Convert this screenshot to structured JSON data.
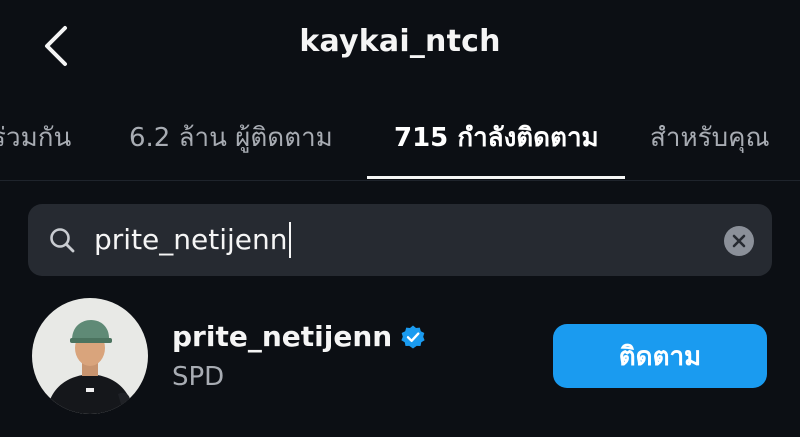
{
  "header": {
    "title": "kaykai_ntch"
  },
  "tabs": [
    {
      "label": "ร่วมกัน"
    },
    {
      "label": "6.2 ล้าน ผู้ติดตาม"
    },
    {
      "label": "715 กำลังติดตาม",
      "active": true
    },
    {
      "label": "สำหรับคุณ"
    }
  ],
  "search": {
    "value": "prite_netijenn"
  },
  "result": {
    "username": "prite_netijenn",
    "verified": true,
    "subtitle": "SPD",
    "follow_label": "ติดตาม"
  },
  "colors": {
    "background": "#0c0f14",
    "accent": "#1a9bf0",
    "search_bg": "#262a31",
    "muted_text": "#a8acb3"
  }
}
